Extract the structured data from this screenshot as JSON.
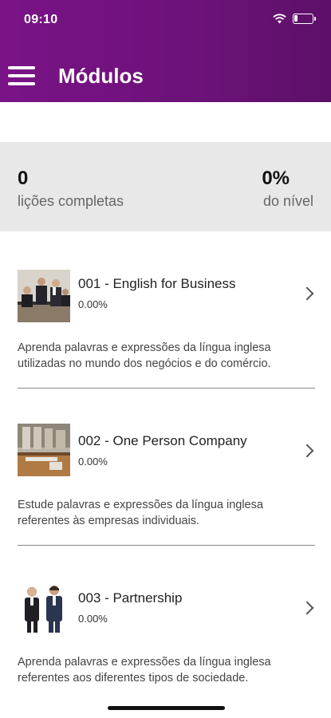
{
  "status_bar": {
    "time": "09:10"
  },
  "header": {
    "title": "Módulos",
    "menu_icon": "hamburger-menu-icon"
  },
  "summary": {
    "completed_lessons_value": "0",
    "completed_lessons_label": "lições completas",
    "level_value": "0%",
    "level_label": "do nível"
  },
  "modules": [
    {
      "title": "001 - English for Business",
      "progress": "0.00%",
      "description_line1": "Aprenda palavras e expressões da língua inglesa",
      "description_line2": "utilizadas no mundo dos negócios e do comércio."
    },
    {
      "title": "002 - One Person Company",
      "progress": "0.00%",
      "description_line1": "Estude palavras e expressões da língua inglesa",
      "description_line2": "referentes às empresas individuais."
    },
    {
      "title": "003 - Partnership",
      "progress": "0.00%",
      "description_line1": "Aprenda palavras e expressões da língua inglesa",
      "description_line2": "referentes aos diferentes tipos de sociedade."
    }
  ],
  "colors": {
    "header": "#7a1387",
    "summary_bg": "#e8e8e8"
  }
}
